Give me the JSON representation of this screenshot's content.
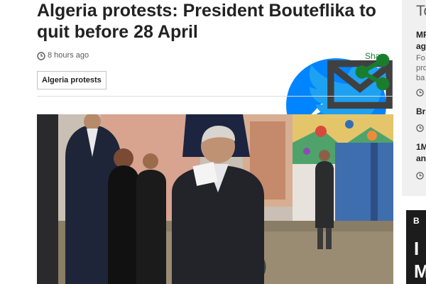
{
  "article": {
    "headline": "Algeria protests: President Bouteflika to quit before 28 April",
    "timestamp": "8 hours ago",
    "share_label": "Share",
    "topic_tag": "Algeria protests"
  },
  "share_buttons": [
    {
      "icon": "facebook-icon",
      "color": "#3b5998"
    },
    {
      "icon": "messenger-icon",
      "color": "#0084ff"
    },
    {
      "icon": "twitter-icon",
      "color": "#1da1f2"
    },
    {
      "icon": "email-icon",
      "color": "#404040"
    },
    {
      "icon": "share-icon",
      "color": "#1a7d2e"
    }
  ],
  "sidebar": {
    "heading": "To",
    "items": [
      {
        "line1": "MP",
        "line2": "ag",
        "desc1": "Fo",
        "desc2": "pro",
        "desc3": "ba"
      },
      {
        "line1": "Br"
      },
      {
        "line1": "1M",
        "line2": "an"
      }
    ]
  },
  "ad": {
    "letter": "B",
    "line1": "I",
    "line2": "M"
  },
  "colors": {
    "accent_green": "#1a7d2e",
    "text": "#222222",
    "meta_grey": "#5a5a5a",
    "sidebar_bg": "#f0f0f0"
  }
}
